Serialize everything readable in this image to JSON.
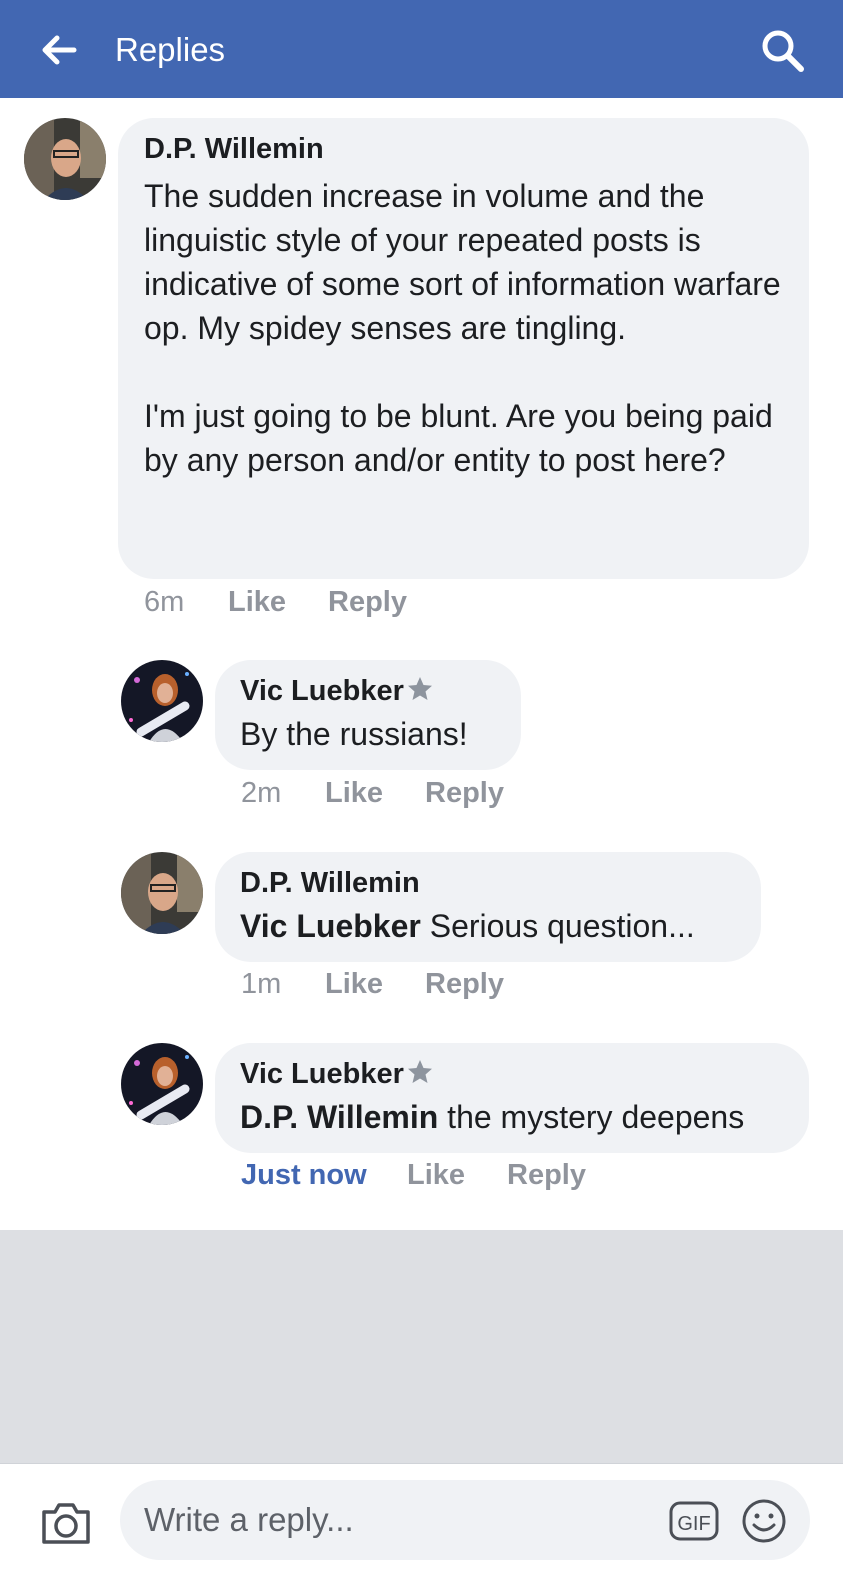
{
  "header": {
    "title": "Replies",
    "back_icon": "arrow-left-icon",
    "search_icon": "search-icon",
    "background": "#4267b2"
  },
  "comments": [
    {
      "author": "D.P. Willemin",
      "text": "The sudden increase in volume and the linguistic style of your repeated posts is indicative of some sort of information warfare op. My spidey senses are tingling.\n\nI'm just going to be blunt. Are you being paid by any person and/or entity to post here?",
      "time": "6m",
      "like_label": "Like",
      "reply_label": "Reply"
    },
    {
      "author": "Vic Luebker",
      "badge_icon": "star-icon",
      "text": "By the russians!",
      "time": "2m",
      "like_label": "Like",
      "reply_label": "Reply"
    },
    {
      "author": "D.P. Willemin",
      "mention": "Vic Luebker",
      "text": " Serious question...",
      "time": "1m",
      "like_label": "Like",
      "reply_label": "Reply"
    },
    {
      "author": "Vic Luebker",
      "badge_icon": "star-icon",
      "mention": "D.P. Willemin",
      "text": " the mystery deepens",
      "time": "Just now",
      "like_label": "Like",
      "reply_label": "Reply"
    }
  ],
  "composer": {
    "placeholder": "Write a reply...",
    "camera_icon": "camera-icon",
    "gif_label": "GIF",
    "emoji_icon": "smiley-icon"
  },
  "colors": {
    "accent": "#4267b2",
    "bubble": "#f0f2f5",
    "meta_text": "#90949c",
    "empty_area": "#dddfe3"
  }
}
